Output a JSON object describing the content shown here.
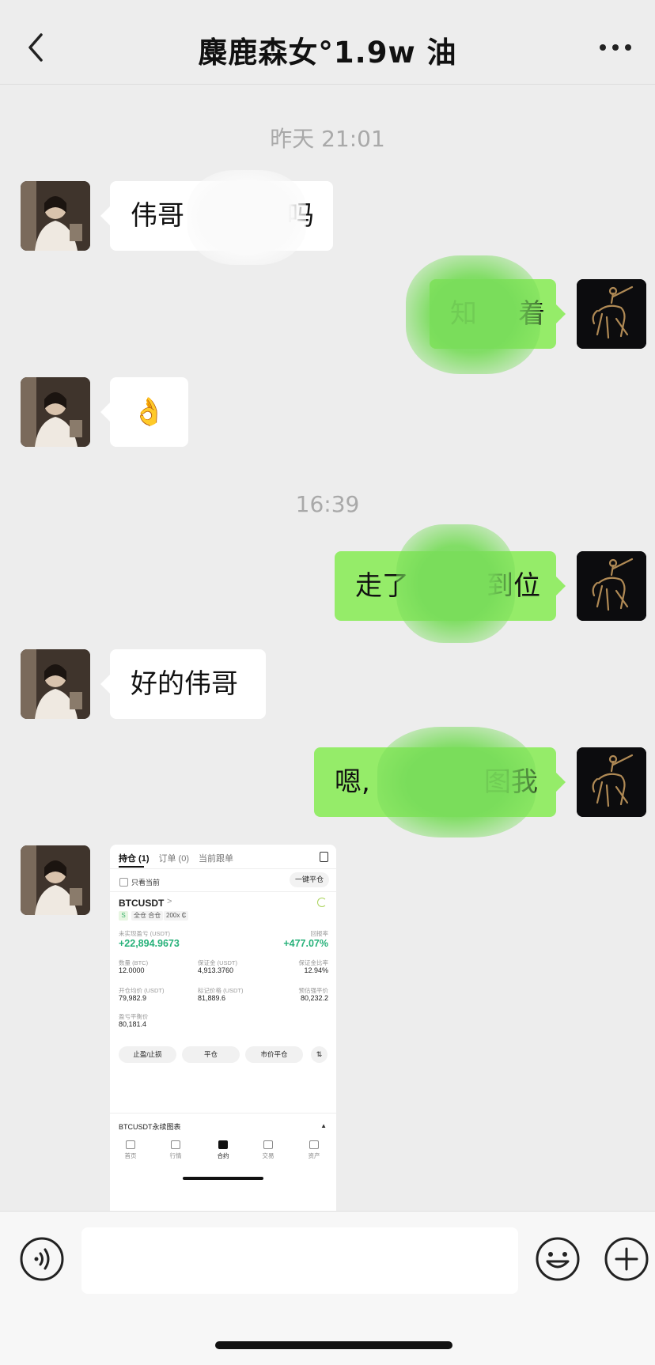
{
  "header": {
    "title": "麋鹿森女°1.9w 油"
  },
  "messages": {
    "time1": "昨天 21:01",
    "m1_visible_start": "伟哥",
    "m1_visible_end": "吗",
    "m2_visible_start": "知",
    "m2_visible_end": "着",
    "m3_emoji": "👌",
    "time2": "16:39",
    "m4_visible_start": "走了",
    "m4_visible_end": "到位",
    "m5": "好的伟哥",
    "m6_visible_start": "嗯,",
    "m6_visible_end": "图我"
  },
  "screenshot": {
    "tabs": [
      "持仓 (1)",
      "订单 (0)",
      "当前跟单"
    ],
    "only_current": "只看当前",
    "close_all": "一键平仓",
    "symbol": "BTCUSDT",
    "symbol_arrow": ">",
    "badge": "S",
    "tag_mode": "全仓 合仓",
    "tag_leverage": "200x ₵",
    "unrealized_label": "未实现盈亏 (USDT)",
    "unrealized_value": "+22,894.9673",
    "roe_label": "回报率",
    "roe_value": "+477.07%",
    "qty_label": "数量 (BTC)",
    "qty_value": "12.0000",
    "margin_label": "保证金 (USDT)",
    "margin_value": "4,913.3760",
    "margin_ratio_label": "保证金比率",
    "margin_ratio_value": "12.94%",
    "entry_label": "开仓均价 (USDT)",
    "entry_value": "79,982.9",
    "mark_label": "标记价格 (USDT)",
    "mark_value": "81,889.6",
    "liq_label": "预估强平价",
    "liq_value": "80,232.2",
    "breakeven_label": "盈亏平衡价",
    "breakeven_value": "80,181.4",
    "btn_tpsl": "止盈/止损",
    "btn_close": "平仓",
    "btn_market_close": "市价平仓",
    "btn_swap": "⇅",
    "chart_row": "BTCUSDT永续图表",
    "chart_caret": "▲",
    "nav": [
      "首页",
      "行情",
      "合约",
      "交易",
      "资产"
    ]
  },
  "input": {
    "placeholder": ""
  }
}
